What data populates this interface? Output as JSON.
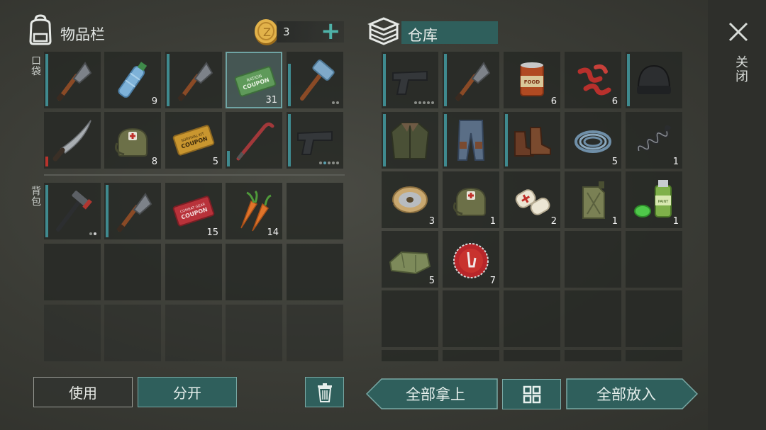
{
  "inventory": {
    "title": "物品栏",
    "coins": "3",
    "add_label": "+",
    "pocket_label": "口袋",
    "backpack_label": "背包",
    "pocket_slots": [
      {
        "item": "shovel",
        "count": ""
      },
      {
        "item": "water-bottle",
        "count": "9"
      },
      {
        "item": "shovel",
        "count": ""
      },
      {
        "item": "ration-coupon",
        "count": "31",
        "text": "RATION COUPON"
      },
      {
        "item": "sledgehammer",
        "count": ""
      },
      {
        "item": "machete",
        "count": ""
      },
      {
        "item": "medkit-bag",
        "count": "8"
      },
      {
        "item": "survival-kit-coupon",
        "count": "5",
        "text": "SURVIVAL KIT COUPON"
      },
      {
        "item": "crowbar",
        "count": ""
      },
      {
        "item": "pistol",
        "count": ""
      }
    ],
    "backpack_slots": [
      {
        "item": "hammer",
        "count": ""
      },
      {
        "item": "shovel",
        "count": ""
      },
      {
        "item": "combat-gear-coupon",
        "count": "15",
        "text": "COMBAT GEAR COUPON"
      },
      {
        "item": "carrots",
        "count": "14"
      },
      {
        "item": "empty",
        "count": ""
      }
    ]
  },
  "storage": {
    "title": "仓库",
    "slots": [
      {
        "item": "pistol",
        "count": ""
      },
      {
        "item": "shovel",
        "count": ""
      },
      {
        "item": "canned-food",
        "count": "6",
        "text": "FOOD"
      },
      {
        "item": "bacon",
        "count": "6"
      },
      {
        "item": "beanie",
        "count": ""
      },
      {
        "item": "jacket",
        "count": ""
      },
      {
        "item": "pants",
        "count": ""
      },
      {
        "item": "boots",
        "count": ""
      },
      {
        "item": "rope",
        "count": "5"
      },
      {
        "item": "spring",
        "count": "1"
      },
      {
        "item": "wire-spool",
        "count": "3"
      },
      {
        "item": "medkit-bag",
        "count": "1"
      },
      {
        "item": "bandages",
        "count": "2"
      },
      {
        "item": "jerrycan",
        "count": "1"
      },
      {
        "item": "spray-paint",
        "count": "1",
        "text": "PAINT"
      },
      {
        "item": "cloth",
        "count": "5"
      },
      {
        "item": "bottle-cap",
        "count": "7"
      }
    ]
  },
  "actions": {
    "use": "使用",
    "split": "分开",
    "take_all": "全部拿上",
    "put_all": "全部放入",
    "close": "关闭"
  },
  "colors": {
    "accent": "#3f8a8f",
    "teal_button": "#2f5f5c",
    "panel": "#262825"
  }
}
